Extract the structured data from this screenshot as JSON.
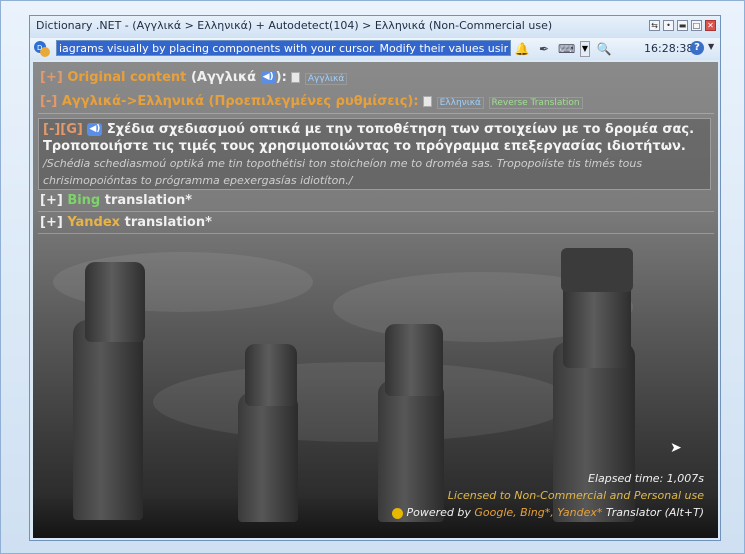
{
  "window": {
    "title": "Dictionary .NET - (Αγγλικά > Ελληνικά) + Autodetect(104) > Ελληνικά (Non-Commercial use)",
    "controls": [
      "⇆",
      "•",
      "▬",
      "□",
      "✕"
    ]
  },
  "toolbar": {
    "search_value": "iagrams visually by placing components with your cursor. Modify their values using the prop",
    "clock": "16:28:38",
    "help": "?"
  },
  "sections": {
    "original": {
      "toggle": "[+]",
      "label": "Original content",
      "lang": "(Αγγλικά",
      "close_paren": "):",
      "link": "Αγγλικά"
    },
    "auto": {
      "toggle": "[-]",
      "label": "Αγγλικά->Ελληνικά",
      "settings": "(Προεπιλεγμένες ρυθμίσεις):",
      "link_lang": "Ελληνικά",
      "link_reverse": "Reverse Translation"
    },
    "google": {
      "toggle": "[-][G]",
      "text": "Σχέδια σχεδιασμού οπτικά με την τοποθέτηση των στοιχείων με το δρομέα σας. Τροποποιήστε τις τιμές τους χρησιμοποιώντας το πρόγραμμα επεξεργασίας ιδιοτήτων.",
      "transliteration": "/Schédia schediasmoú optiká me tin topothétisi ton stoicheíon me to droméa sas. Tropopoiíste tis timés tous chrisimopoióntas to prógramma epexergasías idiotíton./"
    },
    "bing": {
      "toggle": "[+]",
      "name": "Bing",
      "suffix": "translation*"
    },
    "yandex": {
      "toggle": "[+]",
      "name": "Yandex",
      "suffix": "translation*"
    }
  },
  "footer": {
    "elapsed": "Elapsed time: 1,007s",
    "license": "Licensed to Non-Commercial and Personal use",
    "powered_prefix": "Powered by",
    "powered_engines": "Google, Bing*, Yandex*",
    "powered_suffix": "Translator (Alt+T)"
  },
  "colors": {
    "accent_orange": "#e8a13a",
    "bing_green": "#7ed46a",
    "license_gold": "#e0b84a"
  }
}
